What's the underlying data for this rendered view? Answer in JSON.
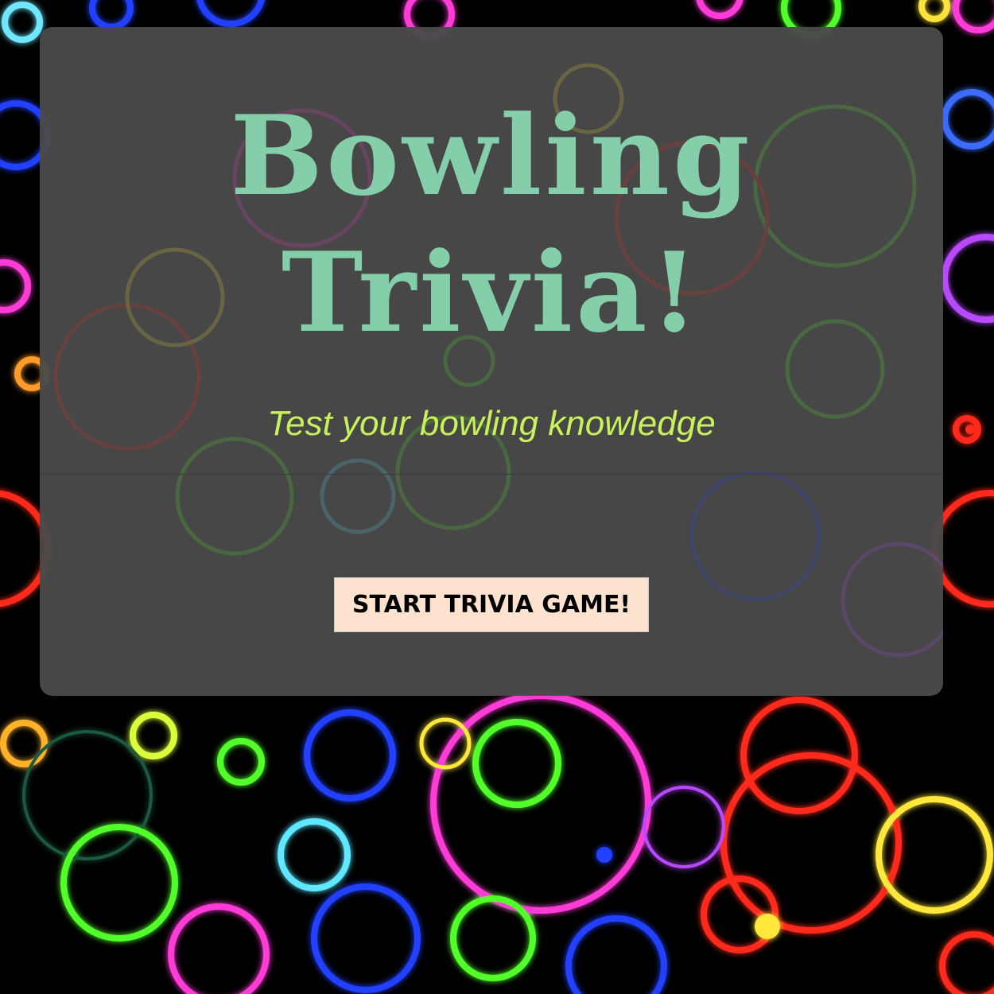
{
  "page": {
    "title_line1": "Bowling",
    "title_line2": "Trivia!",
    "subtitle": "Test your bowling knowledge",
    "start_button_label": "START TRIVIA GAME!"
  },
  "colors": {
    "background": "#000000",
    "panel": "#4a4a4a",
    "title": "#84cfaa",
    "subtitle": "#c8f25a",
    "button_bg": "#fde3cf",
    "button_text": "#000000"
  },
  "background_decor": {
    "style": "neon rings",
    "ring_colors": [
      "#39ff14",
      "#1e3cff",
      "#ff2bd6",
      "#ff2a1a",
      "#ffe83a",
      "#5fe8ff",
      "#a36bff"
    ]
  }
}
